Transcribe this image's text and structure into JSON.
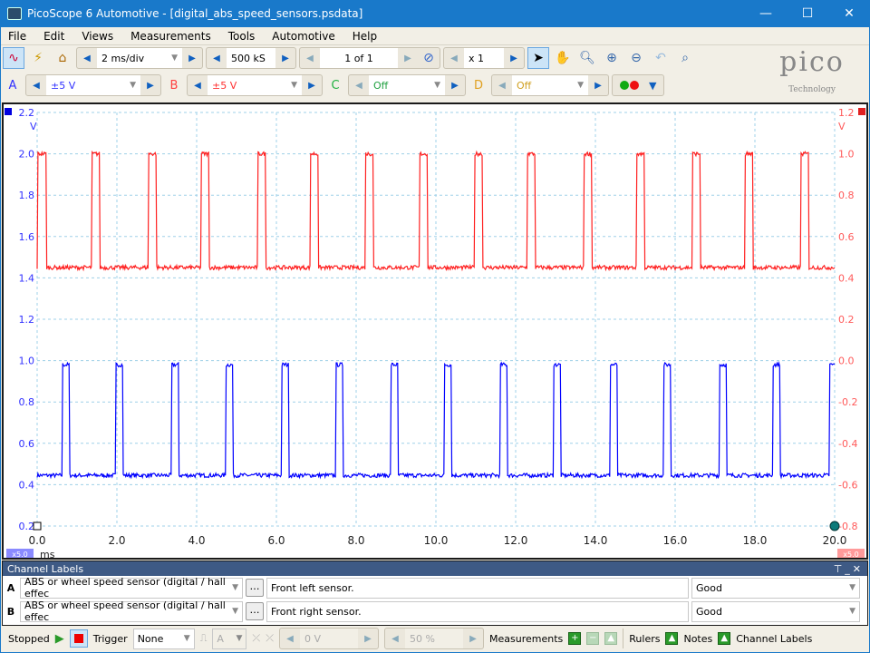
{
  "window": {
    "title": "PicoScope 6 Automotive - [digital_abs_speed_sensors.psdata]",
    "controls": [
      "—",
      "☐",
      "✕"
    ]
  },
  "menu": [
    "File",
    "Edit",
    "Views",
    "Measurements",
    "Tools",
    "Automotive",
    "Help"
  ],
  "toolbar": {
    "timebase": "2 ms/div",
    "samples": "500 kS",
    "buffer": "1 of 1",
    "zoom": "x 1"
  },
  "channels": [
    {
      "id": "A",
      "range": "±5 V",
      "color": "#2020ff"
    },
    {
      "id": "B",
      "range": "±5 V",
      "color": "#ff2a2a"
    },
    {
      "id": "C",
      "range": "Off",
      "color": "#20b040"
    },
    {
      "id": "D",
      "range": "Off",
      "color": "#e0a020"
    }
  ],
  "logo": {
    "text": "pico",
    "sub": "Technology"
  },
  "chart_data": {
    "type": "line",
    "xlabel": "ms",
    "x_ticks": [
      "0.0",
      "2.0",
      "4.0",
      "6.0",
      "8.0",
      "10.0",
      "12.0",
      "14.0",
      "16.0",
      "18.0",
      "20.0"
    ],
    "xlim": [
      0,
      20
    ],
    "left_axis": {
      "unit": "V",
      "ticks": [
        "2.2",
        "2.0",
        "1.8",
        "1.6",
        "1.4",
        "1.2",
        "1.0",
        "0.8",
        "0.6",
        "0.4",
        "0.2"
      ],
      "ylim": [
        0.2,
        2.2
      ],
      "color": "#3030ff"
    },
    "right_axis": {
      "unit": "V",
      "ticks": [
        "1.2",
        "1.0",
        "0.8",
        "0.6",
        "0.4",
        "0.2",
        "0.0",
        "-0.2",
        "-0.4",
        "-0.6",
        "-0.8"
      ],
      "ylim": [
        -0.8,
        1.2
      ],
      "color": "#ff5a5a"
    },
    "zoom_badge": "x5.0",
    "grid": true,
    "series": [
      {
        "channel": "A",
        "axis": "left",
        "color": "#0000ff",
        "low": 0.445,
        "high": 0.98,
        "pulse_width_ms": 0.18,
        "rising_edges_ms": [
          0.63,
          1.98,
          3.38,
          4.73,
          6.13,
          7.48,
          8.86,
          10.2,
          11.61,
          12.95,
          14.36,
          15.7,
          17.11,
          18.45,
          19.86
        ]
      },
      {
        "channel": "B",
        "axis": "right",
        "color": "#ff2020",
        "low": 0.45,
        "high": 1.0,
        "pulse_width_ms": 0.2,
        "rising_edges_ms": [
          0.02,
          1.38,
          2.79,
          4.11,
          5.52,
          6.84,
          8.23,
          9.58,
          10.97,
          12.29,
          13.7,
          15.02,
          16.42,
          17.75,
          19.14
        ]
      }
    ]
  },
  "channel_labels": {
    "title": "Channel Labels",
    "rows": [
      {
        "ch": "A",
        "sensor": "ABS or wheel speed sensor (digital / hall effec",
        "note": "Front left sensor.",
        "status": "Good"
      },
      {
        "ch": "B",
        "sensor": "ABS or wheel speed sensor (digital / hall effec",
        "note": "Front right sensor.",
        "status": "Good"
      }
    ]
  },
  "statusbar": {
    "state": "Stopped",
    "trigger_label": "Trigger",
    "trigger_mode": "None",
    "trigger_channel": "A",
    "threshold": "0 V",
    "pre_trigger": "50 %",
    "measurements": "Measurements",
    "rulers": "Rulers",
    "notes": "Notes",
    "channel_labels": "Channel Labels"
  }
}
